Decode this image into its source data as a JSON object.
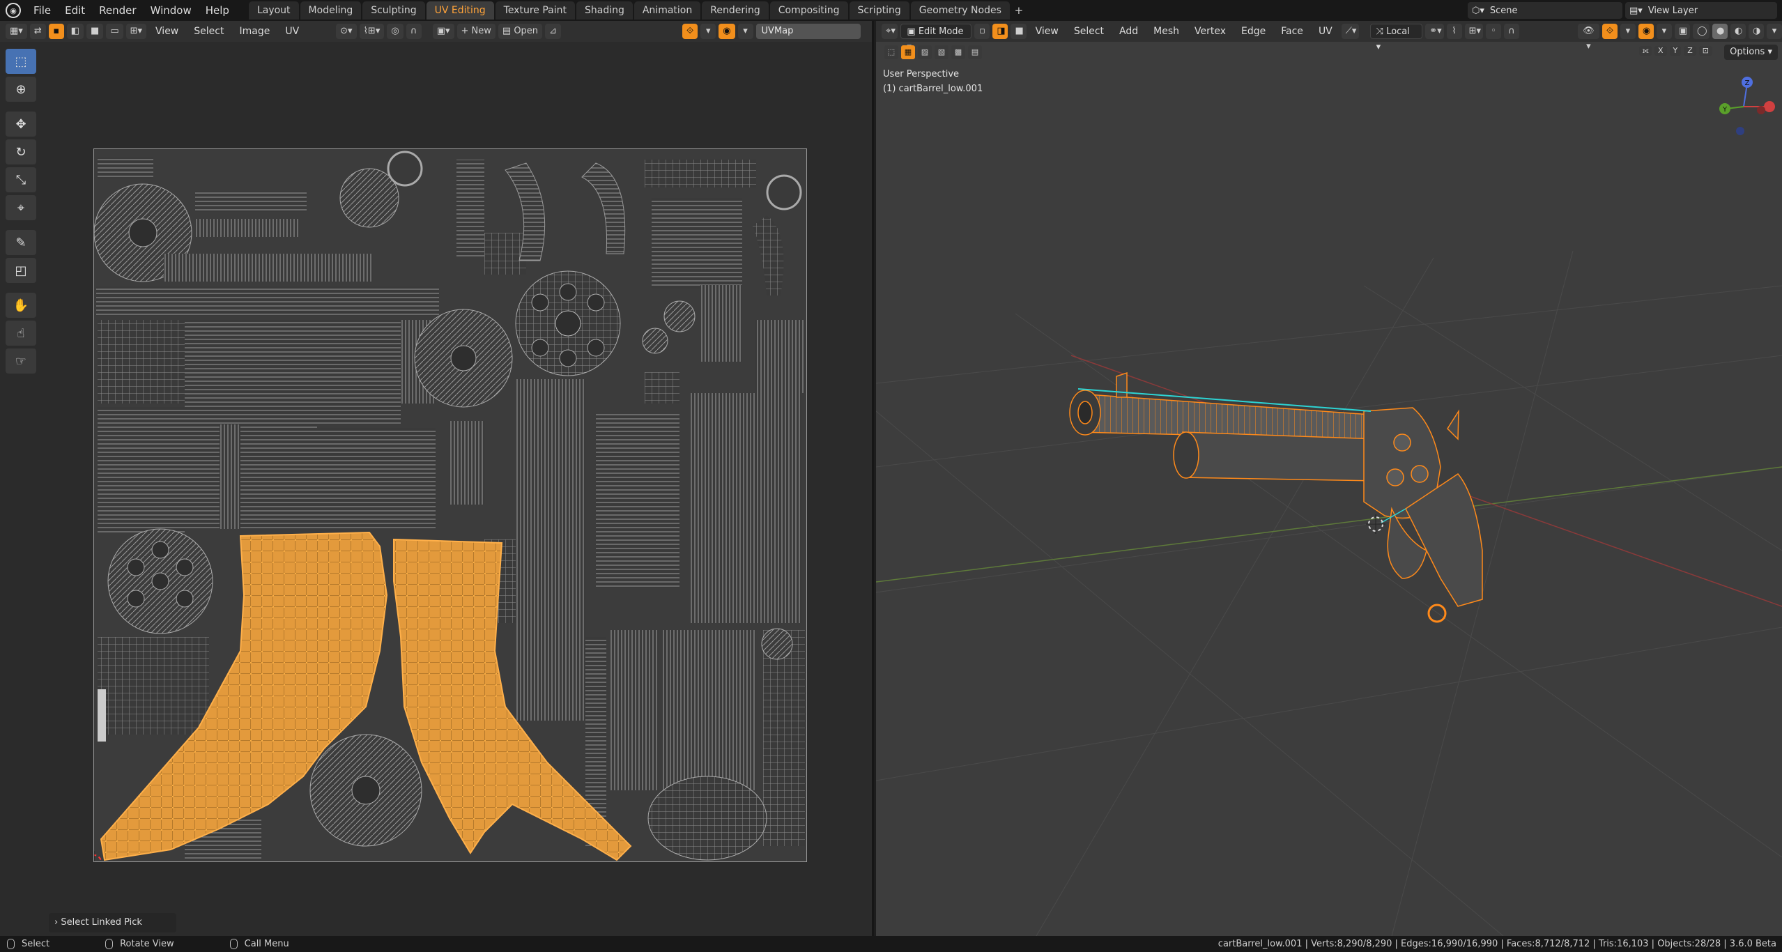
{
  "app": {
    "logo": "blender-logo-icon"
  },
  "menu": [
    "File",
    "Edit",
    "Render",
    "Window",
    "Help"
  ],
  "workspaces": [
    "Layout",
    "Modeling",
    "Sculpting",
    "UV Editing",
    "Texture Paint",
    "Shading",
    "Animation",
    "Rendering",
    "Compositing",
    "Scripting",
    "Geometry Nodes"
  ],
  "active_workspace": "UV Editing",
  "scene": {
    "name": "Scene",
    "view_layer": "View Layer"
  },
  "uv_editor": {
    "menus": [
      "View",
      "Select",
      "Image",
      "UV"
    ],
    "new_label": "New",
    "open_label": "Open",
    "uvmap": "UVMap",
    "operator_panel": "Select Linked Pick"
  },
  "viewport": {
    "mode": "Edit Mode",
    "menus": [
      "View",
      "Select",
      "Add",
      "Mesh",
      "Vertex",
      "Edge",
      "Face",
      "UV"
    ],
    "orientation": "Local",
    "perspective_label": "User Perspective",
    "object_label": "(1) cartBarrel_low.001",
    "options_label": "Options",
    "axes": [
      "X",
      "Y",
      "Z"
    ]
  },
  "status_bar": {
    "select": "Select",
    "rotate": "Rotate View",
    "menu": "Call Menu",
    "stats": "cartBarrel_low.001 | Verts:8,290/8,290 | Edges:16,990/16,990 | Faces:8,712/8,712 | Tris:16,103 | Objects:28/28 | 3.6.0 Beta"
  },
  "colors": {
    "accent": "#ffa33a",
    "selection": "#f2a03a",
    "active_tool": "#4772b3"
  }
}
